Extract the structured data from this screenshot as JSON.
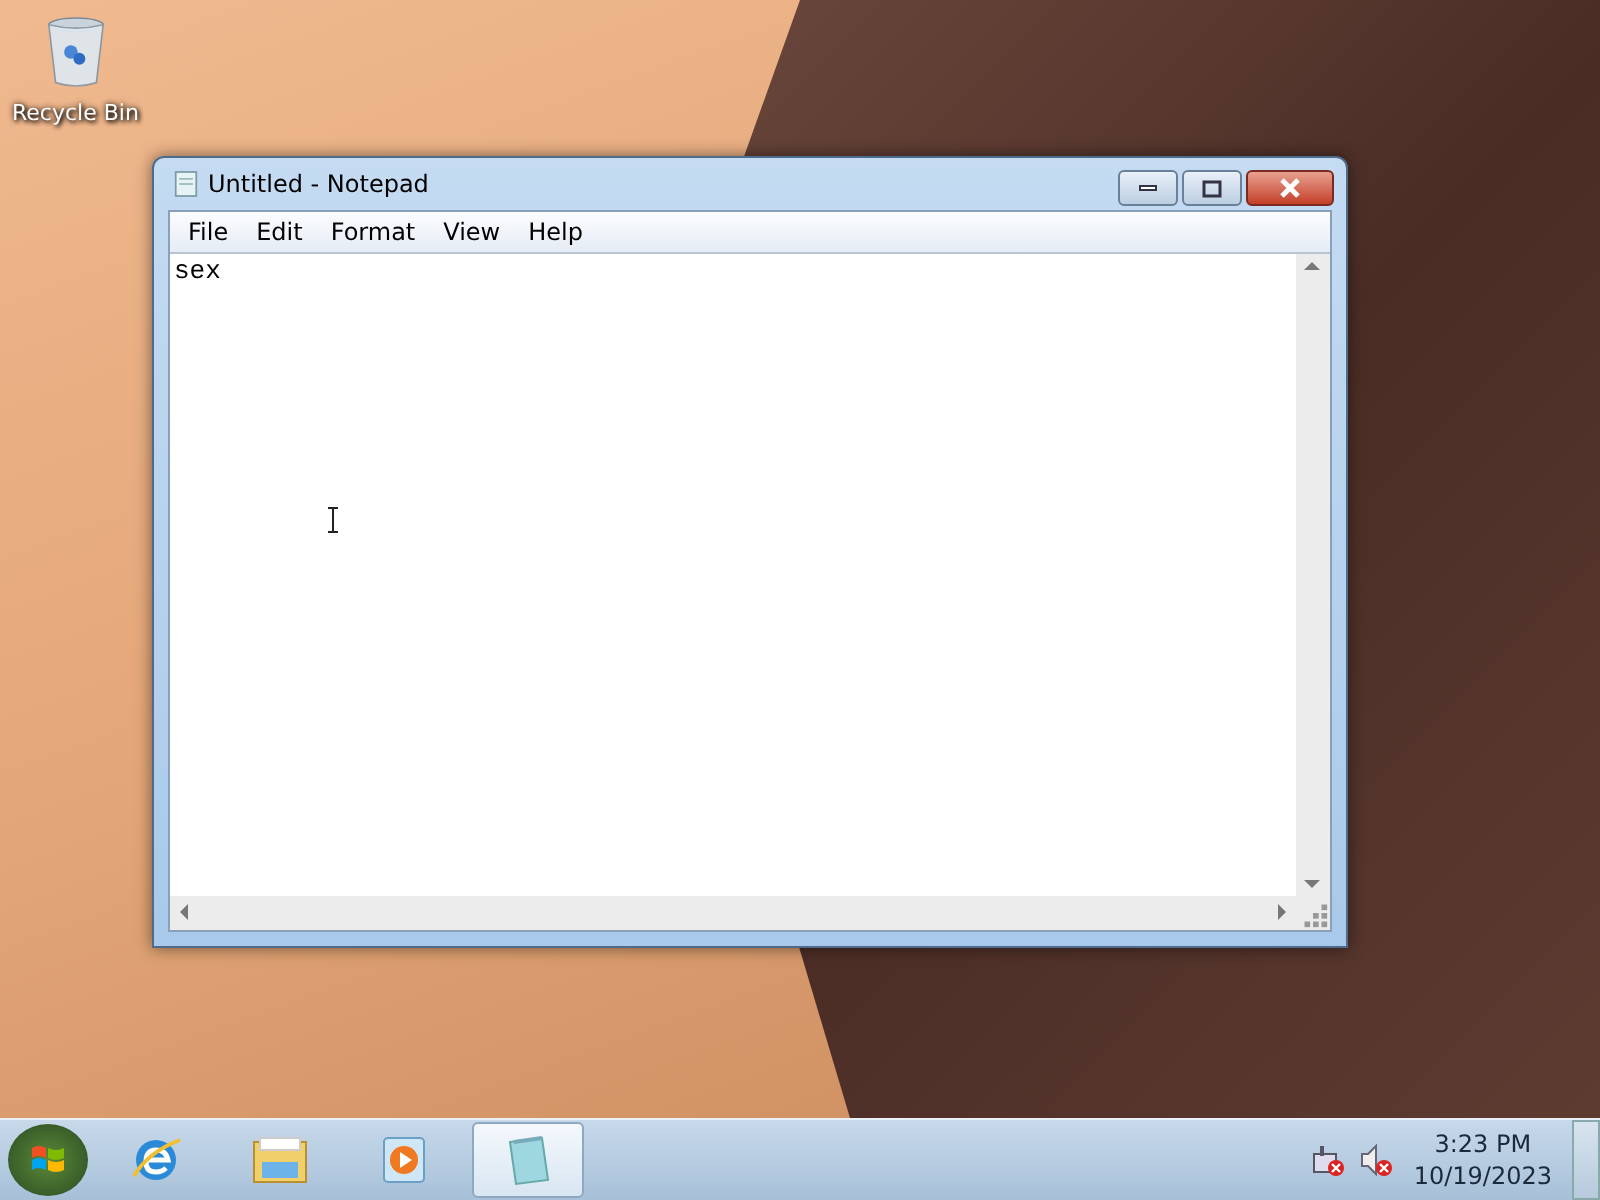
{
  "desktop": {
    "icons": [
      {
        "label": "Recycle Bin"
      }
    ]
  },
  "window": {
    "title": "Untitled - Notepad",
    "menu": [
      "File",
      "Edit",
      "Format",
      "View",
      "Help"
    ],
    "content": "sex"
  },
  "taskbar": {
    "items": [
      {
        "kind": "browser",
        "selected": false
      },
      {
        "kind": "folder",
        "selected": false
      },
      {
        "kind": "media",
        "selected": false
      },
      {
        "kind": "notepad",
        "selected": true
      }
    ],
    "clock": {
      "time": "3:23 PM",
      "date": "10/19/2023"
    }
  }
}
